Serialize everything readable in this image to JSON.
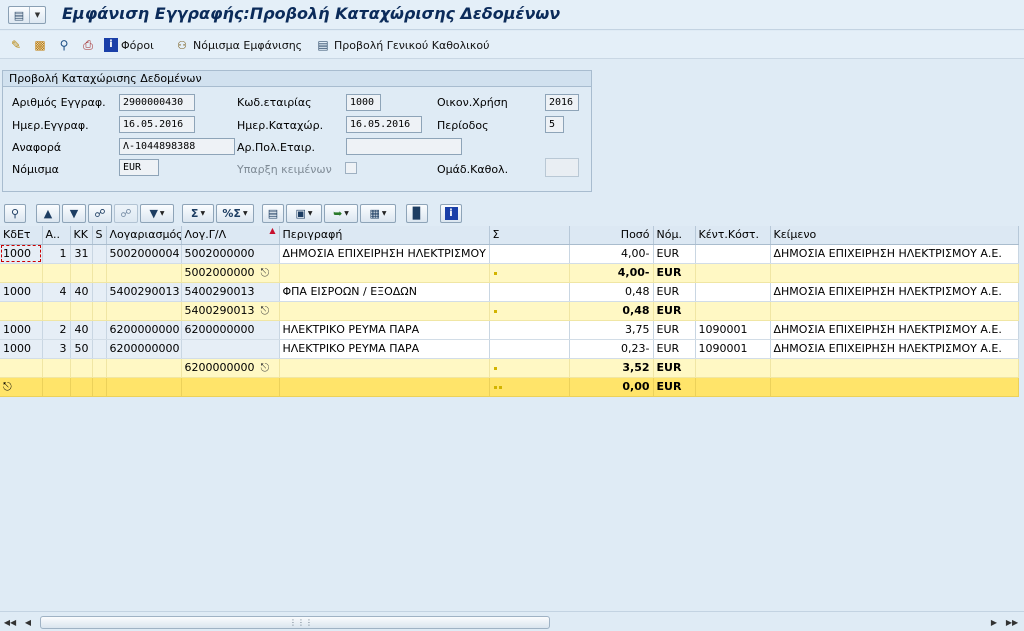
{
  "window": {
    "title": "Εμφάνιση Εγγραφής:Προβολή Καταχώρισης Δεδομένων"
  },
  "app_toolbar": {
    "taxes_label": "Φόροι",
    "currency_label": "Νόμισμα Εμφάνισης",
    "gl_view_label": "Προβολή Γενικού Καθολικού"
  },
  "header_panel": {
    "title": "Προβολή Καταχώρισης Δεδομένων",
    "doc_number_label": "Αριθμός Εγγραφ.",
    "doc_number_value": "2900000430",
    "company_code_label": "Κωδ.εταιρίας",
    "company_code_value": "1000",
    "fiscal_year_label": "Οικον.Χρήση",
    "fiscal_year_value": "2016",
    "doc_date_label": "Ημερ.Εγγραφ.",
    "doc_date_value": "16.05.2016",
    "posting_date_label": "Ημερ.Καταχώρ.",
    "posting_date_value": "16.05.2016",
    "period_label": "Περίοδος",
    "period_value": "5",
    "reference_label": "Αναφορά",
    "reference_value": "Λ-1044898388",
    "partner_company_label": "Αρ.Πολ.Εταιρ.",
    "partner_company_value": "",
    "currency_label": "Νόμισμα",
    "currency_value": "EUR",
    "texts_exist_label": "Υπαρξη κειμένων",
    "ledger_group_label": "Ομάδ.Καθολ.",
    "ledger_group_value": ""
  },
  "grid": {
    "columns": [
      "ΚδΕτ",
      "Α..",
      "ΚΚ",
      "S",
      "Λογαριασμός",
      "Λογ.Γ/Λ",
      "Περιγραφή",
      "Σ",
      "Ποσό",
      "Νόμ.",
      "Κέντ.Κόστ.",
      "Κείμενο"
    ],
    "rows": [
      {
        "type": "data",
        "cells": [
          "1000",
          "1",
          "31",
          "",
          "5002000004",
          "5002000000",
          "ΔΗΜΟΣΙΑ ΕΠΙΧΕΙΡΗΣΗ ΗΛΕΚΤΡΙΣΜΟΥ",
          "",
          "4,00-",
          "EUR",
          "",
          "ΔΗΜΟΣΙΑ ΕΠΙΧΕΙΡΗΣΗ ΗΛΕΚΤΡΙΣΜΟΥ Α.Ε."
        ]
      },
      {
        "type": "subtotal",
        "gl": "5002000000",
        "amount": "4,00-",
        "currency": "EUR"
      },
      {
        "type": "data",
        "cells": [
          "1000",
          "4",
          "40",
          "",
          "5400290013",
          "5400290013",
          "ΦΠΑ ΕΙΣΡΟΩΝ / ΕΞΟΔΩΝ",
          "",
          "0,48",
          "EUR",
          "",
          "ΔΗΜΟΣΙΑ ΕΠΙΧΕΙΡΗΣΗ ΗΛΕΚΤΡΙΣΜΟΥ Α.Ε."
        ]
      },
      {
        "type": "subtotal",
        "gl": "5400290013",
        "amount": "0,48",
        "currency": "EUR"
      },
      {
        "type": "data",
        "cells": [
          "1000",
          "2",
          "40",
          "",
          "6200000000",
          "6200000000",
          "ΗΛΕΚΤΡΙΚΟ ΡΕΥΜΑ ΠΑΡΑ",
          "",
          "3,75",
          "EUR",
          "1090001",
          "ΔΗΜΟΣΙΑ ΕΠΙΧΕΙΡΗΣΗ ΗΛΕΚΤΡΙΣΜΟΥ Α.Ε."
        ]
      },
      {
        "type": "data",
        "cells": [
          "1000",
          "3",
          "50",
          "",
          "6200000000",
          "",
          "ΗΛΕΚΤΡΙΚΟ ΡΕΥΜΑ ΠΑΡΑ",
          "",
          "0,23-",
          "EUR",
          "1090001",
          "ΔΗΜΟΣΙΑ ΕΠΙΧΕΙΡΗΣΗ ΗΛΕΚΤΡΙΣΜΟΥ Α.Ε."
        ]
      },
      {
        "type": "subtotal",
        "gl": "6200000000",
        "amount": "3,52",
        "currency": "EUR"
      },
      {
        "type": "total",
        "amount": "0,00",
        "currency": "EUR"
      }
    ]
  },
  "colors": {
    "subtotal_row": "#fff8c4",
    "total_row": "#ffe46a",
    "title_text": "#0b2b5a"
  }
}
